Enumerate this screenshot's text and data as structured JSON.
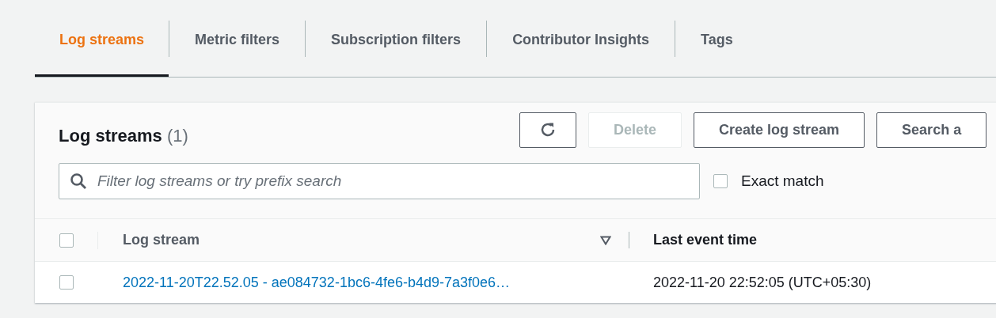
{
  "tabs": [
    {
      "label": "Log streams",
      "selected": true
    },
    {
      "label": "Metric filters",
      "selected": false
    },
    {
      "label": "Subscription filters",
      "selected": false
    },
    {
      "label": "Contributor Insights",
      "selected": false
    },
    {
      "label": "Tags",
      "selected": false
    }
  ],
  "panel": {
    "title": "Log streams",
    "count": "(1)",
    "buttons": [
      {
        "kind": "refresh",
        "disabled": false
      },
      {
        "kind": "text",
        "label": "Delete",
        "disabled": true
      },
      {
        "kind": "text",
        "label": "Create log stream",
        "disabled": false
      },
      {
        "kind": "text",
        "label": "Search a",
        "disabled": false
      }
    ],
    "search": {
      "placeholder": "Filter log streams or try prefix search"
    },
    "exact_match": {
      "label": "Exact match",
      "checked": false
    }
  },
  "table": {
    "select_all_checked": false,
    "columns": [
      {
        "label": "Log stream",
        "sorted": true
      },
      {
        "label": "Last event time",
        "sorted": false
      }
    ],
    "rows": [
      {
        "checked": false,
        "log_stream": "2022-11-20T22.52.05 - ae084732-1bc6-4fe6-b4d9-7a3f0e6…",
        "last_event_time": "2022-11-20 22:52:05 (UTC+05:30)"
      }
    ]
  }
}
